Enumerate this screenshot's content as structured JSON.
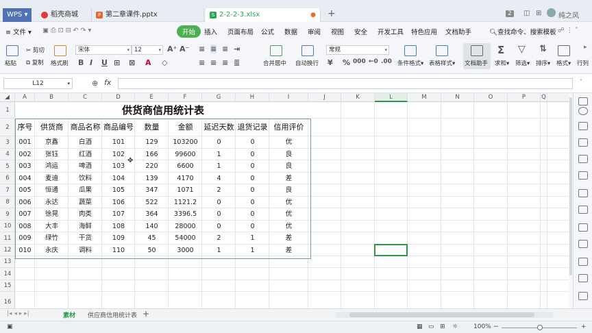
{
  "titlebar": {
    "logo": "WPS",
    "tabs": [
      {
        "label": "稻壳商城",
        "icon_color": "#e03c31"
      },
      {
        "label": "第二章课件.pptx",
        "icon_color": "#e8672e"
      },
      {
        "label": "2-2-2-3.xlsx",
        "icon_color": "#27a456"
      }
    ],
    "add_tab": "+",
    "badge": "2",
    "user": "纯之风"
  },
  "menubar": {
    "file": "文件",
    "items": [
      "开始",
      "插入",
      "页面布局",
      "公式",
      "数据",
      "审阅",
      "视图",
      "安全",
      "开发工具",
      "特色应用",
      "文档助手"
    ],
    "search": "查找命令、搜索模板"
  },
  "ribbon": {
    "paste": "粘贴",
    "cut": "剪切",
    "copy": "复制",
    "format_painter": "格式刷",
    "font_name": "宋体",
    "font_size": "12",
    "merge_center": "合并居中",
    "wrap_text": "自动换行",
    "number_format": "常规",
    "conditional_format": "条件格式",
    "table_style": "表格样式",
    "doc_assistant": "文档助手",
    "sum": "求和",
    "filter": "筛选",
    "sort": "排序",
    "format": "格式",
    "row_col": "行列"
  },
  "formula_bar": {
    "name_box": "L12",
    "fx": "fx",
    "content": ""
  },
  "columns": [
    "A",
    "B",
    "C",
    "D",
    "E",
    "F",
    "G",
    "H",
    "I",
    "J",
    "K",
    "L",
    "M",
    "N",
    "O",
    "P",
    "Q"
  ],
  "selected_column": "L",
  "rows": [
    "1",
    "2",
    "3",
    "4",
    "5",
    "6",
    "7",
    "8",
    "9",
    "10",
    "11",
    "12",
    "13",
    "14",
    "15",
    "16"
  ],
  "sheet": {
    "title": "供货商信用统计表",
    "headers": [
      "序号",
      "供货商",
      "商品名称",
      "商品编号",
      "数量",
      "金额",
      "延迟天数",
      "退货记录",
      "信用评价"
    ],
    "data": [
      [
        "001",
        "京鑫",
        "白酒",
        "101",
        "129",
        "103200",
        "0",
        "0",
        "优"
      ],
      [
        "002",
        "张钰",
        "红酒",
        "102",
        "166",
        "99600",
        "1",
        "0",
        "良"
      ],
      [
        "003",
        "鸿运",
        "啤酒",
        "103",
        "220",
        "6600",
        "1",
        "0",
        "良"
      ],
      [
        "004",
        "麦迪",
        "饮料",
        "104",
        "139",
        "4170",
        "4",
        "0",
        "差"
      ],
      [
        "005",
        "恒通",
        "瓜果",
        "105",
        "347",
        "1071",
        "2",
        "0",
        "良"
      ],
      [
        "006",
        "永达",
        "蔬菜",
        "106",
        "522",
        "1121.2",
        "0",
        "0",
        "优"
      ],
      [
        "007",
        "徐晃",
        "肉类",
        "107",
        "364",
        "3396.5",
        "0",
        "0",
        "优"
      ],
      [
        "008",
        "大丰",
        "海鲜",
        "108",
        "140",
        "28000",
        "0",
        "0",
        "优"
      ],
      [
        "009",
        "绿竹",
        "干货",
        "109",
        "45",
        "54000",
        "2",
        "1",
        "差"
      ],
      [
        "010",
        "永庆",
        "调料",
        "110",
        "50",
        "3000",
        "1",
        "1",
        "差"
      ]
    ]
  },
  "sheet_tabs": [
    "素材",
    "供应商信用统计表"
  ],
  "status": {
    "zoom": "100%"
  },
  "colors": {
    "accent_green": "#2a9a4a",
    "wps_blue": "#5172b5"
  }
}
